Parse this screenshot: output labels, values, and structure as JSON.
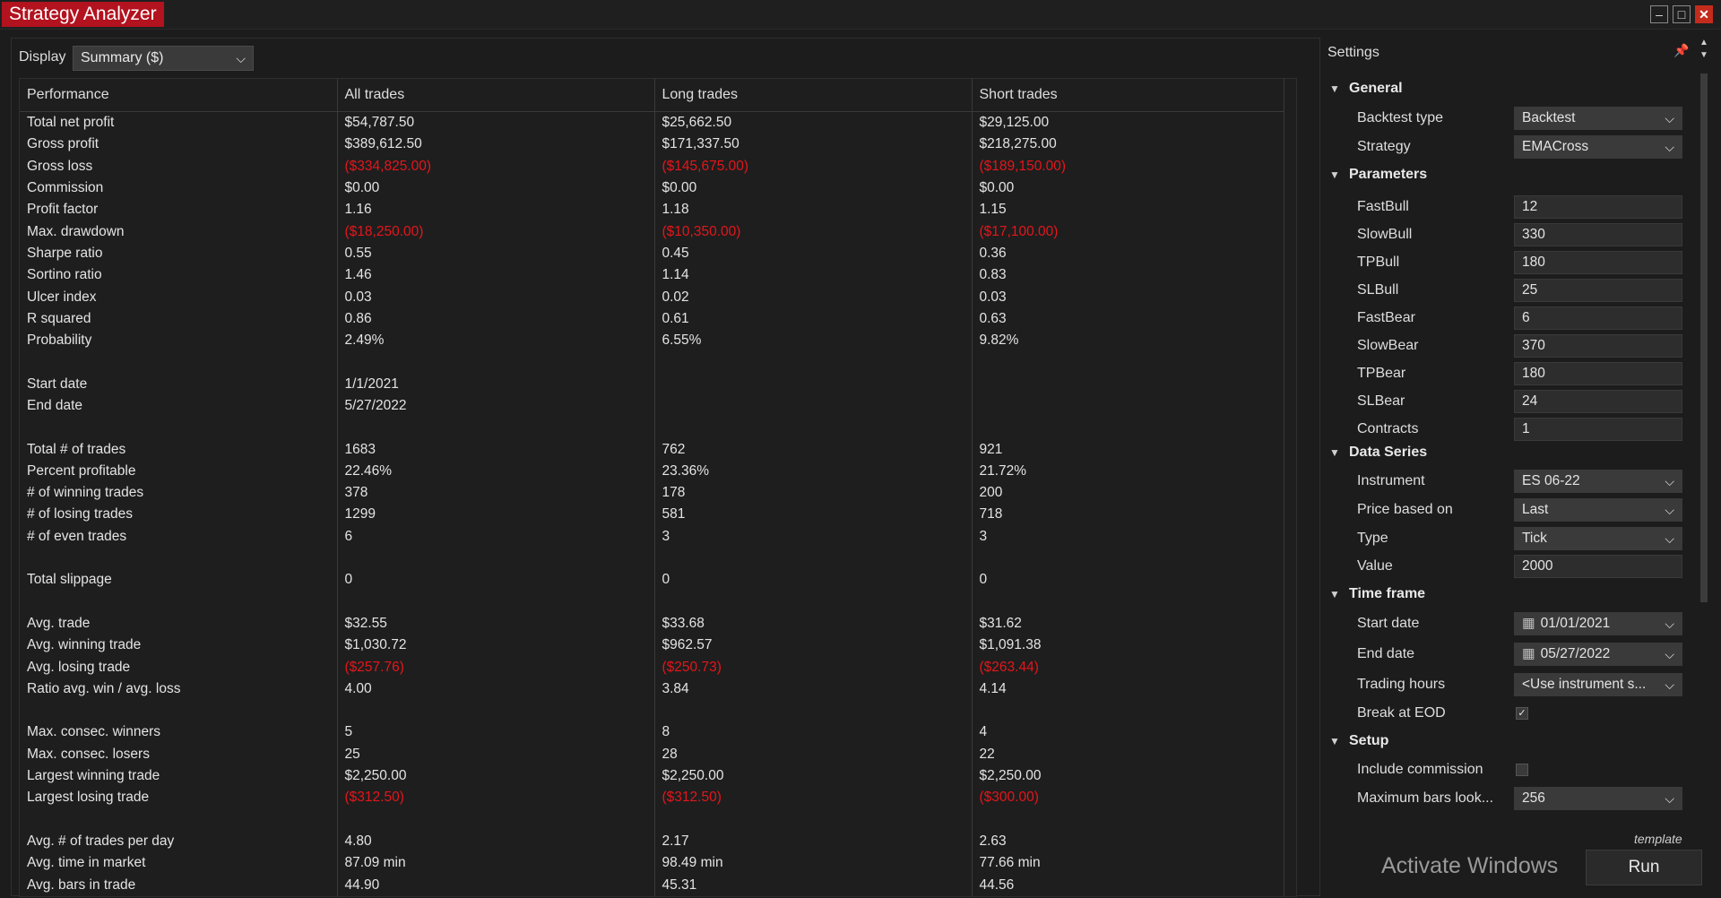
{
  "window": {
    "title": "Strategy Analyzer"
  },
  "display": {
    "label": "Display",
    "selected": "Summary ($)"
  },
  "table": {
    "columns": [
      "Performance",
      "All trades",
      "Long trades",
      "Short trades"
    ],
    "rows": [
      [
        "Total net profit",
        "$54,787.50",
        "$25,662.50",
        "$29,125.00"
      ],
      [
        "Gross profit",
        "$389,612.50",
        "$171,337.50",
        "$218,275.00"
      ],
      [
        "Gross loss",
        "($334,825.00)",
        "($145,675.00)",
        "($189,150.00)"
      ],
      [
        "Commission",
        "$0.00",
        "$0.00",
        "$0.00"
      ],
      [
        "Profit factor",
        "1.16",
        "1.18",
        "1.15"
      ],
      [
        "Max. drawdown",
        "($18,250.00)",
        "($10,350.00)",
        "($17,100.00)"
      ],
      [
        "Sharpe ratio",
        "0.55",
        "0.45",
        "0.36"
      ],
      [
        "Sortino ratio",
        "1.46",
        "1.14",
        "0.83"
      ],
      [
        "Ulcer index",
        "0.03",
        "0.02",
        "0.03"
      ],
      [
        "R squared",
        "0.86",
        "0.61",
        "0.63"
      ],
      [
        "Probability",
        "2.49%",
        "6.55%",
        "9.82%"
      ],
      [
        "",
        "",
        "",
        ""
      ],
      [
        "Start date",
        "1/1/2021",
        "",
        ""
      ],
      [
        "End date",
        "5/27/2022",
        "",
        ""
      ],
      [
        "",
        "",
        "",
        ""
      ],
      [
        "Total # of trades",
        "1683",
        "762",
        "921"
      ],
      [
        "Percent profitable",
        "22.46%",
        "23.36%",
        "21.72%"
      ],
      [
        "# of winning trades",
        "378",
        "178",
        "200"
      ],
      [
        "# of losing trades",
        "1299",
        "581",
        "718"
      ],
      [
        "# of even trades",
        "6",
        "3",
        "3"
      ],
      [
        "",
        "",
        "",
        ""
      ],
      [
        "Total slippage",
        "0",
        "0",
        "0"
      ],
      [
        "",
        "",
        "",
        ""
      ],
      [
        "Avg. trade",
        "$32.55",
        "$33.68",
        "$31.62"
      ],
      [
        "Avg. winning trade",
        "$1,030.72",
        "$962.57",
        "$1,091.38"
      ],
      [
        "Avg. losing trade",
        "($257.76)",
        "($250.73)",
        "($263.44)"
      ],
      [
        "Ratio avg. win / avg. loss",
        "4.00",
        "3.84",
        "4.14"
      ],
      [
        "",
        "",
        "",
        ""
      ],
      [
        "Max. consec. winners",
        "5",
        "8",
        "4"
      ],
      [
        "Max. consec. losers",
        "25",
        "28",
        "22"
      ],
      [
        "Largest winning trade",
        "$2,250.00",
        "$2,250.00",
        "$2,250.00"
      ],
      [
        "Largest losing trade",
        "($312.50)",
        "($312.50)",
        "($300.00)"
      ],
      [
        "",
        "",
        "",
        ""
      ],
      [
        "Avg. # of trades per day",
        "4.80",
        "2.17",
        "2.63"
      ],
      [
        "Avg. time in market",
        "87.09 min",
        "98.49 min",
        "77.66 min"
      ],
      [
        "Avg. bars in trade",
        "44.90",
        "45.31",
        "44.56"
      ]
    ]
  },
  "settings": {
    "header": "Settings",
    "categories": {
      "general": "General",
      "parameters": "Parameters",
      "data_series": "Data Series",
      "time_frame": "Time frame",
      "setup": "Setup"
    },
    "backtest_type": {
      "label": "Backtest type",
      "value": "Backtest"
    },
    "strategy": {
      "label": "Strategy",
      "value": "EMACross"
    },
    "params": [
      {
        "label": "FastBull",
        "value": "12"
      },
      {
        "label": "SlowBull",
        "value": "330"
      },
      {
        "label": "TPBull",
        "value": "180"
      },
      {
        "label": "SLBull",
        "value": "25"
      },
      {
        "label": "FastBear",
        "value": "6"
      },
      {
        "label": "SlowBear",
        "value": "370"
      },
      {
        "label": "TPBear",
        "value": "180"
      },
      {
        "label": "SLBear",
        "value": "24"
      },
      {
        "label": "Contracts",
        "value": "1"
      }
    ],
    "instrument": {
      "label": "Instrument",
      "value": "ES 06-22"
    },
    "price_based_on": {
      "label": "Price based on",
      "value": "Last"
    },
    "type": {
      "label": "Type",
      "value": "Tick"
    },
    "value": {
      "label": "Value",
      "value": "2000"
    },
    "start_date": {
      "label": "Start date",
      "value": "01/01/2021"
    },
    "end_date": {
      "label": "End date",
      "value": "05/27/2022"
    },
    "trading_hours": {
      "label": "Trading hours",
      "value": "<Use instrument s..."
    },
    "break_at_eod": {
      "label": "Break at EOD",
      "checked": true
    },
    "include_commission": {
      "label": "Include commission",
      "checked": false
    },
    "max_bars_lookback": {
      "label": "Maximum bars look...",
      "value": "256"
    },
    "template_link": "template",
    "run_label": "Run",
    "activation_watermark": "Activate Windows"
  },
  "colors": {
    "title_bg": "#b3121f",
    "negative": "#e4161b",
    "background": "#1c1c1c"
  }
}
